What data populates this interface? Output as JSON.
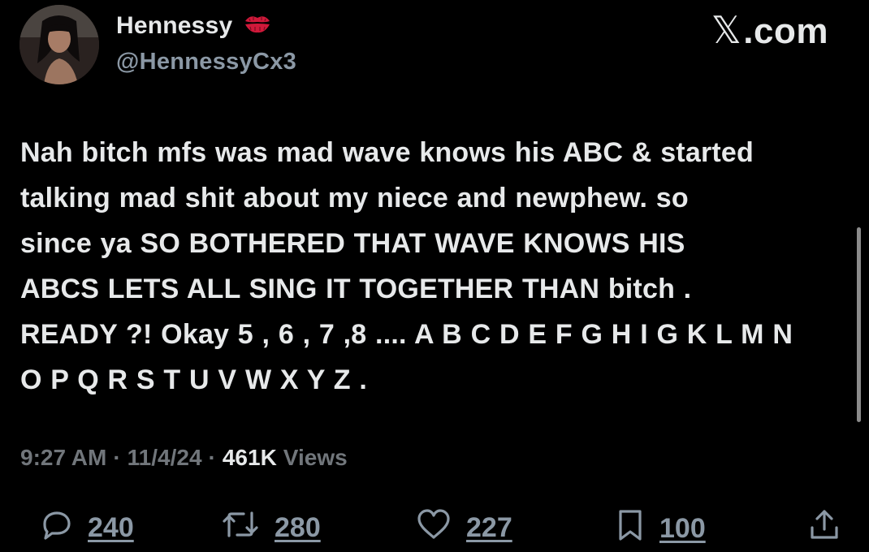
{
  "user": {
    "display_name": "Hennessy",
    "badge_emoji": "kiss-mark-icon",
    "handle": "@HennessyCx3"
  },
  "brand": {
    "x_symbol": "𝕏",
    "suffix": ".com"
  },
  "tweet": {
    "text": "Nah bitch mfs was mad wave knows his ABC & started\ntalking mad shit about my niece and newphew. so\nsince ya SO BOTHERED THAT WAVE KNOWS HIS\nABCS LETS ALL SING IT TOGETHER THAN bitch .\nREADY ?! Okay 5 , 6 , 7 ,8 .... A B C D E F G H I G K L M N\nO P Q R S T U V W X Y Z ."
  },
  "meta": {
    "time": "9:27 AM",
    "sep1": "·",
    "date": "11/4/24",
    "sep2": "·",
    "views_count": "461K",
    "views_label": "Views"
  },
  "actions": {
    "replies": "240",
    "reposts": "280",
    "likes": "227",
    "bookmarks": "100"
  },
  "colors": {
    "background": "#000000",
    "primary_text": "#e7e9ea",
    "secondary_text": "#71767b",
    "icon": "#8b98a5",
    "kiss": "#d0193a"
  }
}
